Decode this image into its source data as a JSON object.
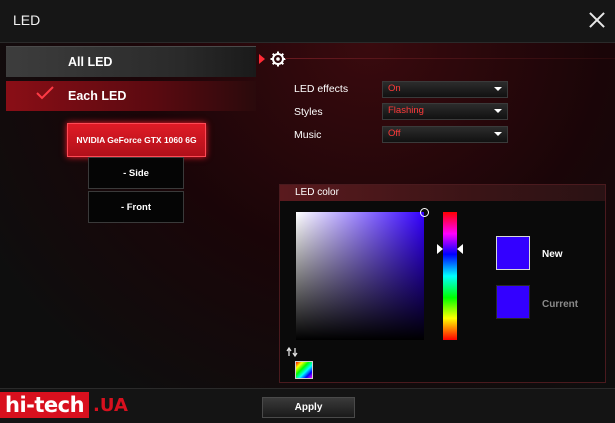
{
  "window": {
    "title": "LED",
    "close_icon": "close-icon"
  },
  "sidebar": {
    "items": [
      {
        "label": "All LED",
        "selected": false
      },
      {
        "label": "Each LED",
        "selected": true,
        "icon": "check-icon"
      }
    ],
    "device": {
      "label": "NVIDIA GeForce GTX 1060 6G"
    },
    "sub_items": [
      {
        "label": "- Side"
      },
      {
        "label": "- Front"
      }
    ]
  },
  "settings": {
    "header_icon": "gear-icon",
    "rows": [
      {
        "label": "LED effects",
        "value": "On"
      },
      {
        "label": "Styles",
        "value": "Flashing"
      },
      {
        "label": "Music",
        "value": "Off"
      }
    ]
  },
  "led_color": {
    "header": "LED color",
    "new_label": "New",
    "current_label": "Current",
    "new_color": "#3300ff",
    "current_color": "#3300ff",
    "swap_icon": "swap-icon",
    "palette_icon": "palette-icon"
  },
  "footer": {
    "apply_label": "Apply",
    "brand_main": "hi-tech",
    "brand_suffix": ".UA"
  },
  "colors": {
    "accent": "#d8101e",
    "dropdown_text": "#ff3a3a",
    "background": "#0d0d0d"
  }
}
